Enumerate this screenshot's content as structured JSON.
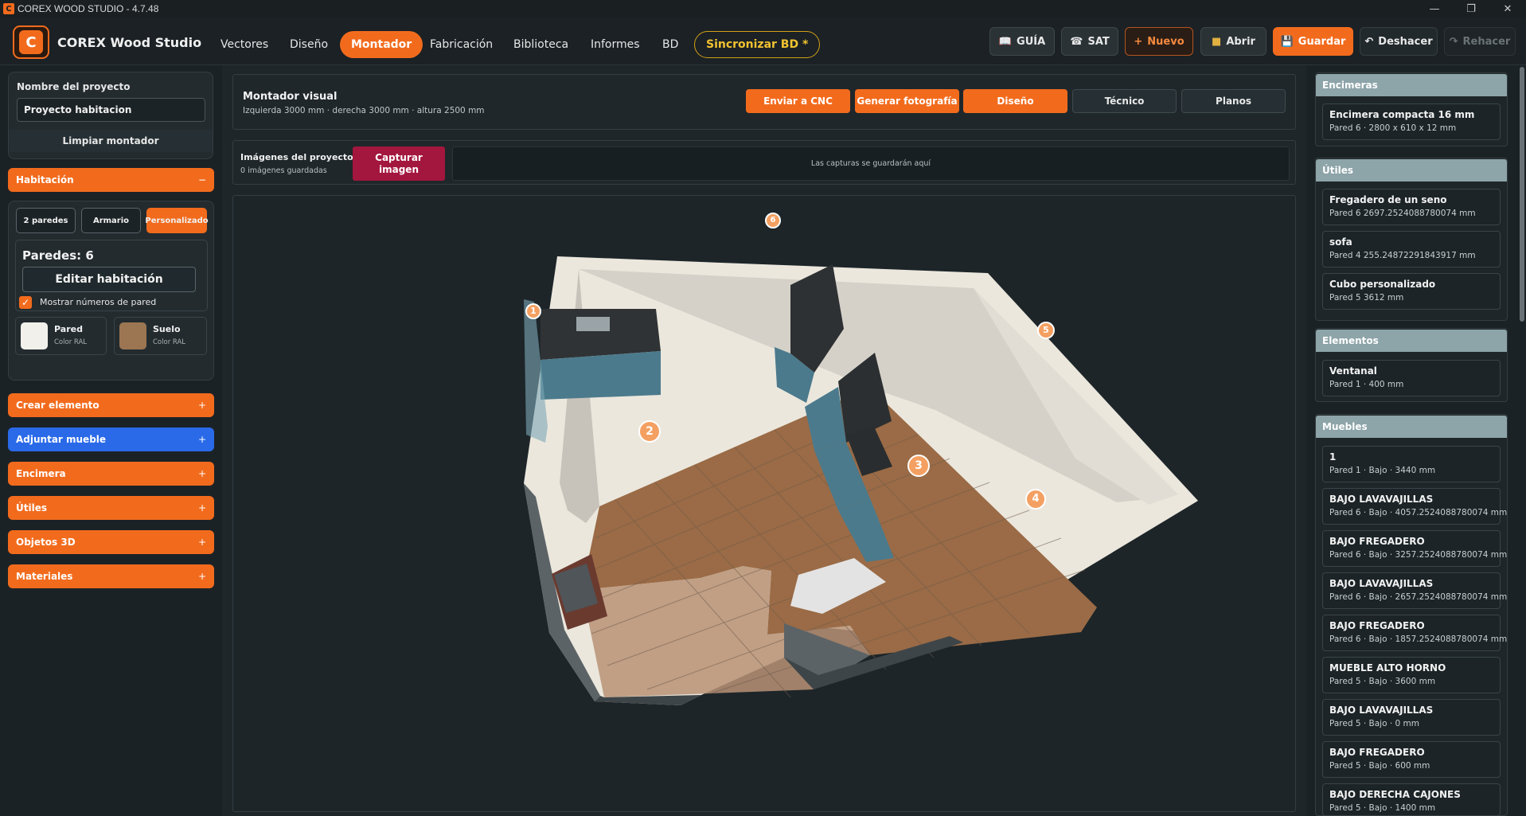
{
  "window": {
    "title": "COREX WOOD STUDIO - 4.7.48",
    "app_icon": "C"
  },
  "nav": {
    "brand": "COREX Wood Studio",
    "logo": "C",
    "items": [
      "Vectores",
      "Diseño",
      "Montador",
      "Fabricación",
      "Biblioteca",
      "Informes",
      "BD"
    ],
    "active": "Montador",
    "sync_label": "Sincronizar BD *"
  },
  "toolbar": {
    "guide": "GUÍA",
    "sat": "SAT",
    "new": "Nuevo",
    "open": "Abrir",
    "save": "Guardar",
    "undo": "Deshacer",
    "redo": "Rehacer"
  },
  "sidebar": {
    "project_label": "Nombre del proyecto",
    "project_value": "Proyecto habitacion",
    "clear_btn": "Limpiar montador",
    "room_header": "Habitación",
    "room_header_toggle": "−",
    "room_types": [
      "2 paredes",
      "Armario",
      "Personalizado"
    ],
    "room_type_active": "Personalizado",
    "walls_label": "Paredes: 6",
    "edit_room": "Editar habitación",
    "show_wall_numbers": "Mostrar números de pared",
    "show_wall_numbers_checked": true,
    "swatches": [
      {
        "label": "Pared",
        "sub": "Color RAL",
        "color": "#f2f0ea"
      },
      {
        "label": "Suelo",
        "sub": "Color RAL",
        "color": "#9c7552"
      }
    ],
    "accordions": [
      {
        "label": "Crear elemento",
        "toggle": "+",
        "color": "orange"
      },
      {
        "label": "Adjuntar mueble",
        "toggle": "+",
        "color": "blue"
      },
      {
        "label": "Encimera",
        "toggle": "+",
        "color": "orange"
      },
      {
        "label": "Útiles",
        "toggle": "+",
        "color": "orange"
      },
      {
        "label": "Objetos 3D",
        "toggle": "+",
        "color": "orange"
      },
      {
        "label": "Materiales",
        "toggle": "+",
        "color": "orange"
      }
    ]
  },
  "main": {
    "title": "Montador visual",
    "subtitle": "Izquierda 3000 mm · derecha 3000 mm · altura 2500 mm",
    "buttons": [
      "Enviar a CNC",
      "Generar fotografía",
      "Diseño",
      "Técnico",
      "Planos"
    ],
    "images_title": "Imágenes del proyecto",
    "images_count": "0 imágenes guardadas",
    "capture_btn": "Capturar imagen",
    "captures_placeholder": "Las capturas se guardarán aquí",
    "wall_markers": [
      "1",
      "2",
      "3",
      "4",
      "5",
      "6"
    ]
  },
  "right": {
    "sections": [
      {
        "title": "Encimeras",
        "items": [
          {
            "t": "Encimera compacta 16 mm",
            "s": "Pared 6 · 2800 x 610 x 12 mm"
          }
        ]
      },
      {
        "title": "Útiles",
        "items": [
          {
            "t": "Fregadero de un seno",
            "s": "Pared 6 2697.2524088780074 mm"
          },
          {
            "t": "sofa",
            "s": "Pared 4 255.24872291843917 mm"
          },
          {
            "t": "Cubo personalizado",
            "s": "Pared 5 3612 mm"
          }
        ]
      },
      {
        "title": "Elementos",
        "items": [
          {
            "t": "Ventanal",
            "s": "Pared 1 · 400 mm"
          }
        ]
      },
      {
        "title": "Muebles",
        "items": [
          {
            "t": "1",
            "s": "Pared 1 · Bajo · 3440 mm"
          },
          {
            "t": "BAJO LAVAVAJILLAS",
            "s": "Pared 6 · Bajo · 4057.2524088780074 mm"
          },
          {
            "t": "BAJO FREGADERO",
            "s": "Pared 6 · Bajo · 3257.2524088780074 mm"
          },
          {
            "t": "BAJO LAVAVAJILLAS",
            "s": "Pared 6 · Bajo · 2657.2524088780074 mm"
          },
          {
            "t": "BAJO FREGADERO",
            "s": "Pared 6 · Bajo · 1857.2524088780074 mm"
          },
          {
            "t": "MUEBLE ALTO HORNO",
            "s": "Pared 5 · Bajo · 3600 mm"
          },
          {
            "t": "BAJO LAVAVAJILLAS",
            "s": "Pared 5 · Bajo · 0 mm"
          },
          {
            "t": "BAJO FREGADERO",
            "s": "Pared 5 · Bajo · 600 mm"
          },
          {
            "t": "BAJO DERECHA CAJONES",
            "s": "Pared 5 · Bajo · 1400 mm"
          }
        ]
      }
    ]
  },
  "colors": {
    "accent": "#f26b1d",
    "blue": "#2a6ae8",
    "capture": "#a3163e",
    "section_header": "#8da4a9"
  }
}
